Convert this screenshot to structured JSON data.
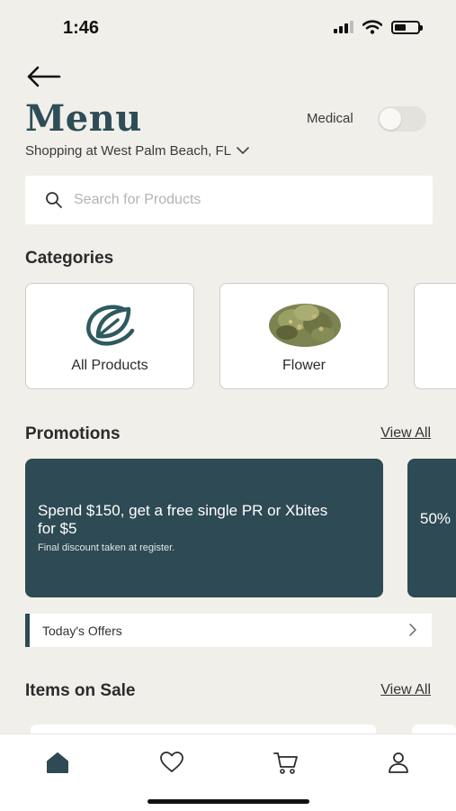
{
  "status": {
    "time": "1:46"
  },
  "header": {
    "title": "Menu",
    "medical_label": "Medical",
    "location": "Shopping at West Palm Beach, FL"
  },
  "search": {
    "placeholder": "Search for Products"
  },
  "categories": {
    "title": "Categories",
    "items": [
      {
        "label": "All Products",
        "icon": "leaf-logo-icon"
      },
      {
        "label": "Flower",
        "icon": "flower-bud-image"
      }
    ]
  },
  "promotions": {
    "title": "Promotions",
    "view_all": "View All",
    "cards": [
      {
        "headline": "Spend $150, get a free single PR or Xbites for $5",
        "subtext": "Final discount taken at register."
      },
      {
        "headline": "50%"
      }
    ]
  },
  "offers": {
    "label": "Today's Offers"
  },
  "sale": {
    "title": "Items on Sale",
    "view_all": "View All"
  },
  "tabbar": {
    "items": [
      "home-icon",
      "heart-icon",
      "cart-icon",
      "profile-icon"
    ]
  },
  "colors": {
    "brand": "#2e4a54",
    "background": "#f1efea",
    "title": "#2e4d57"
  }
}
